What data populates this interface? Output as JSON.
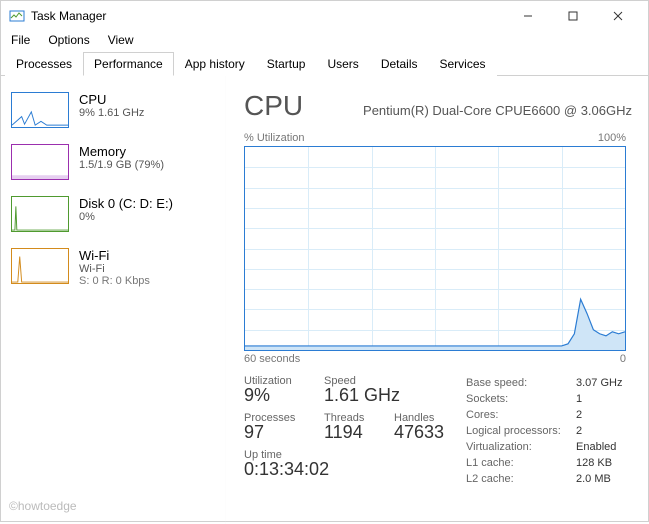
{
  "window": {
    "title": "Task Manager"
  },
  "menu": {
    "file": "File",
    "options": "Options",
    "view": "View"
  },
  "tabs": {
    "processes": "Processes",
    "performance": "Performance",
    "app_history": "App history",
    "startup": "Startup",
    "users": "Users",
    "details": "Details",
    "services": "Services"
  },
  "sidebar": {
    "cpu": {
      "title": "CPU",
      "sub": "9% 1.61 GHz"
    },
    "memory": {
      "title": "Memory",
      "sub": "1.5/1.9 GB (79%)"
    },
    "disk": {
      "title": "Disk 0 (C: D: E:)",
      "sub": "0%"
    },
    "wifi": {
      "title": "Wi-Fi",
      "sub": "Wi-Fi",
      "sub2": "S: 0 R: 0 Kbps"
    }
  },
  "main": {
    "heading": "CPU",
    "processor": "Pentium(R) Dual-Core CPUE6600 @ 3.06GHz",
    "g_label_left": "% Utilization",
    "g_label_right": "100%",
    "g_x_left": "60 seconds",
    "g_x_right": "0",
    "stats": {
      "utilization_label": "Utilization",
      "utilization": "9%",
      "speed_label": "Speed",
      "speed": "1.61 GHz",
      "processes_label": "Processes",
      "processes": "97",
      "threads_label": "Threads",
      "threads": "1194",
      "handles_label": "Handles",
      "handles": "47633",
      "uptime_label": "Up time",
      "uptime": "0:13:34:02"
    },
    "right": {
      "base_speed_k": "Base speed:",
      "base_speed_v": "3.07 GHz",
      "sockets_k": "Sockets:",
      "sockets_v": "1",
      "cores_k": "Cores:",
      "cores_v": "2",
      "lp_k": "Logical processors:",
      "lp_v": "2",
      "virt_k": "Virtualization:",
      "virt_v": "Enabled",
      "l1_k": "L1 cache:",
      "l1_v": "128 KB",
      "l2_k": "L2 cache:",
      "l2_v": "2.0 MB"
    }
  },
  "watermark": "©howtoedge",
  "chart_data": {
    "type": "line",
    "title": "% Utilization",
    "xlabel": "60 seconds → 0",
    "ylabel": "% Utilization",
    "ylim": [
      0,
      100
    ],
    "x_seconds_ago": [
      60,
      55,
      50,
      45,
      40,
      35,
      30,
      25,
      20,
      15,
      12,
      10,
      9,
      8,
      7,
      6,
      5,
      4,
      3,
      2,
      1,
      0
    ],
    "values": [
      2,
      2,
      2,
      2,
      2,
      2,
      2,
      2,
      2,
      2,
      2,
      2,
      3,
      8,
      25,
      18,
      10,
      8,
      7,
      9,
      8,
      9
    ]
  },
  "colors": {
    "cpu": "#2b7cd3",
    "memory": "#9b2fae",
    "disk": "#4f9a2f",
    "wifi": "#d38b1c"
  }
}
